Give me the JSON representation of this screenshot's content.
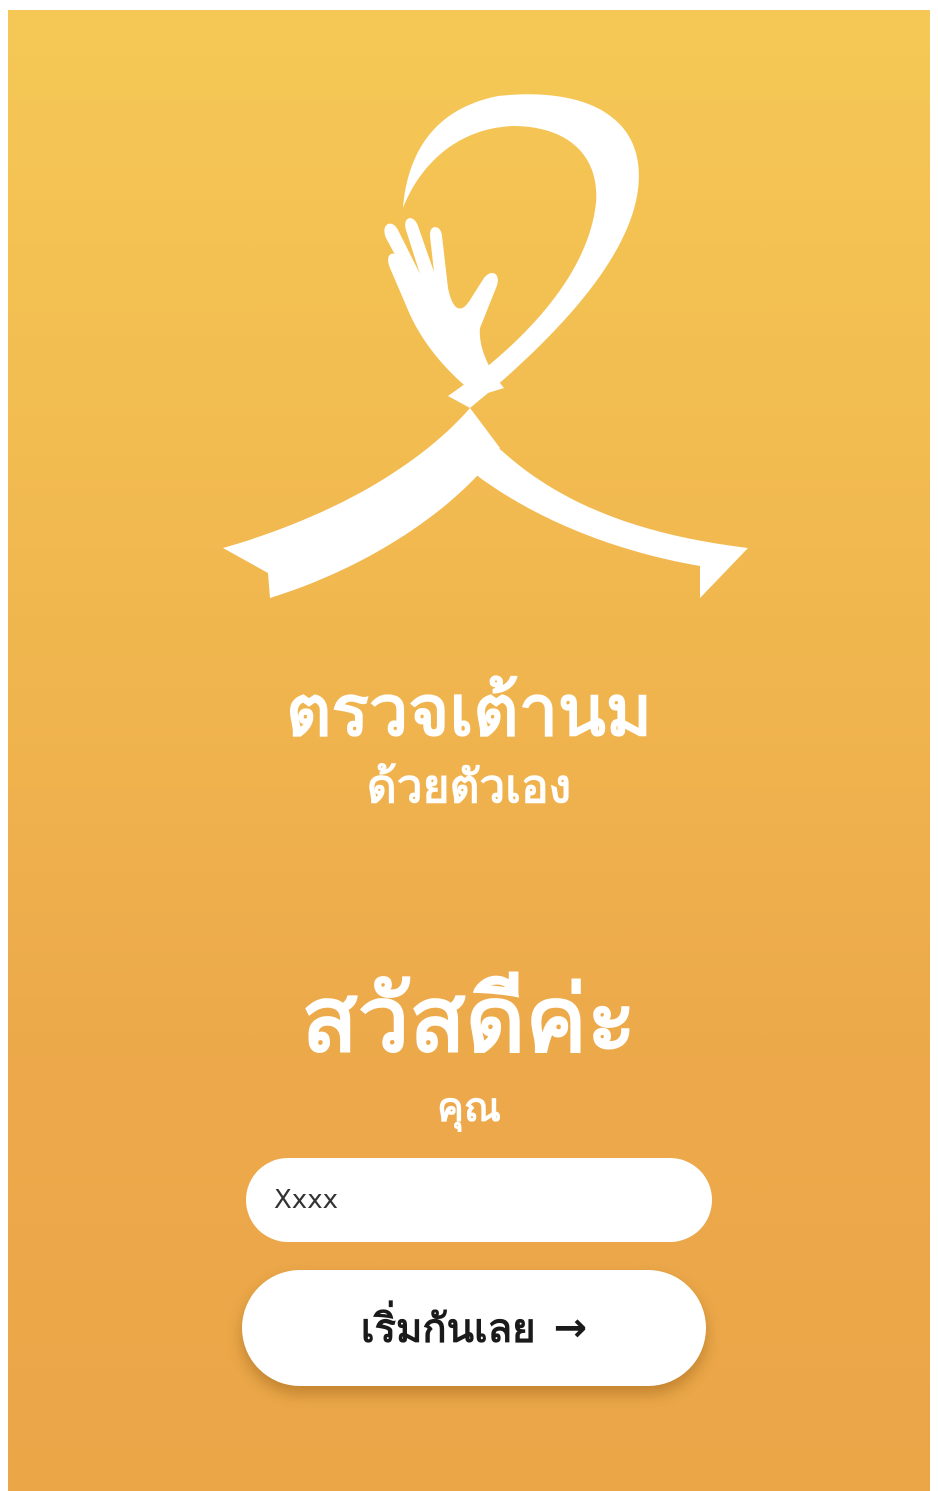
{
  "theme": {
    "background_top": "#f5c855",
    "background_bottom": "#eaa647",
    "foreground": "#ffffff"
  },
  "logo": {
    "icon": "pink-ribbon-hand-icon"
  },
  "app_title": {
    "line1": "ตรวจเต้านม",
    "line2": "ด้วยตัวเอง"
  },
  "greeting": {
    "title": "สวัสดีค่ะ",
    "subtitle": "คุณ"
  },
  "name_input": {
    "value": "Xxxx"
  },
  "start_button": {
    "label": "เริ่มกันเลย",
    "arrow": "→"
  }
}
